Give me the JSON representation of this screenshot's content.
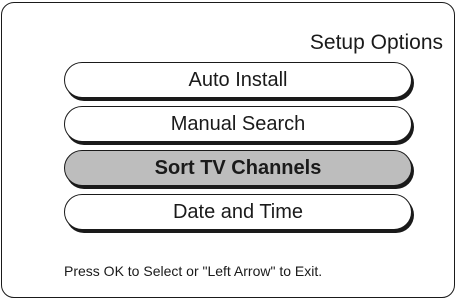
{
  "screen": {
    "title": "Setup Options",
    "footer_hint": "Press OK to Select or \"Left Arrow\" to Exit."
  },
  "menu": {
    "selected_index": 2,
    "items": [
      {
        "label": "Auto Install"
      },
      {
        "label": "Manual Search"
      },
      {
        "label": "Sort TV Channels"
      },
      {
        "label": "Date and Time"
      }
    ]
  },
  "colors": {
    "frame": "#1a1a1a",
    "background": "#ffffff",
    "selected_fill": "#bdbdbd"
  }
}
